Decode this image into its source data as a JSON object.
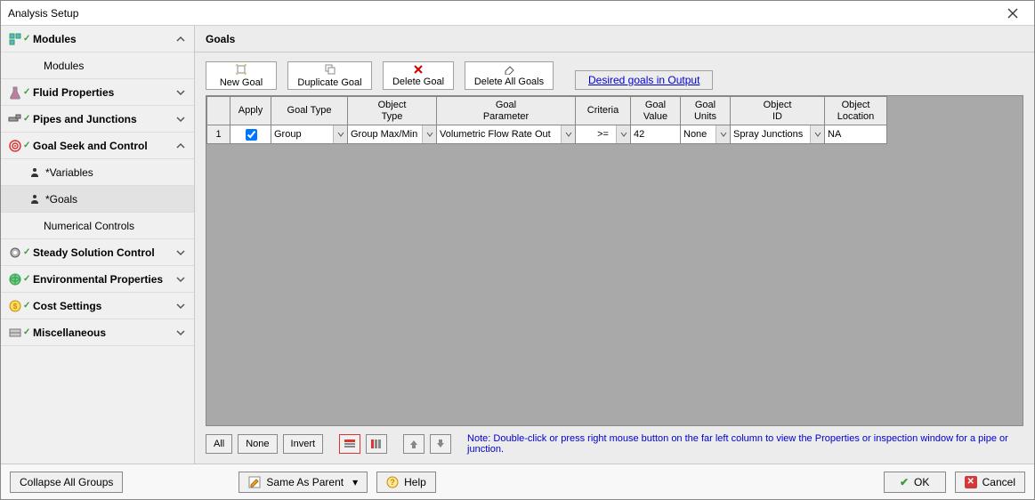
{
  "title": "Analysis Setup",
  "sidebar": {
    "groups": [
      {
        "label": "Modules",
        "expanded": true,
        "items": [
          {
            "label": "Modules"
          }
        ]
      },
      {
        "label": "Fluid Properties",
        "expanded": false
      },
      {
        "label": "Pipes and Junctions",
        "expanded": false
      },
      {
        "label": "Goal Seek and Control",
        "expanded": true,
        "items": [
          {
            "label": "*Variables"
          },
          {
            "label": "*Goals",
            "selected": true
          },
          {
            "label": "Numerical Controls"
          }
        ]
      },
      {
        "label": "Steady Solution Control",
        "expanded": false
      },
      {
        "label": "Environmental Properties",
        "expanded": false
      },
      {
        "label": "Cost Settings",
        "expanded": false
      },
      {
        "label": "Miscellaneous",
        "expanded": false
      }
    ]
  },
  "main": {
    "heading": "Goals",
    "toolbar": {
      "new_goal": "New Goal",
      "duplicate_goal": "Duplicate Goal",
      "delete_goal": "Delete Goal",
      "delete_all_goals": "Delete All Goals",
      "desired_goals": "Desired goals in Output"
    },
    "columns": [
      "",
      "Apply",
      "Goal Type",
      "Object\nType",
      "Goal\nParameter",
      "Criteria",
      "Goal\nValue",
      "Goal\nUnits",
      "Object\nID",
      "Object\nLocation"
    ],
    "rows": [
      {
        "n": "1",
        "apply": true,
        "goal_type": "Group",
        "object_type": "Group Max/Min",
        "goal_parameter": "Volumetric Flow Rate Out",
        "criteria": ">=",
        "goal_value": "42",
        "goal_units": "None",
        "object_id": "Spray Junctions",
        "object_location": "NA"
      }
    ],
    "footer": {
      "all": "All",
      "none": "None",
      "invert": "Invert",
      "note": "Note: Double-click or press right mouse button on the far left column to view the Properties or inspection window for a pipe or junction."
    }
  },
  "bottom": {
    "collapse": "Collapse All Groups",
    "same_as_parent": "Same As Parent",
    "help": "Help",
    "ok": "OK",
    "cancel": "Cancel"
  }
}
